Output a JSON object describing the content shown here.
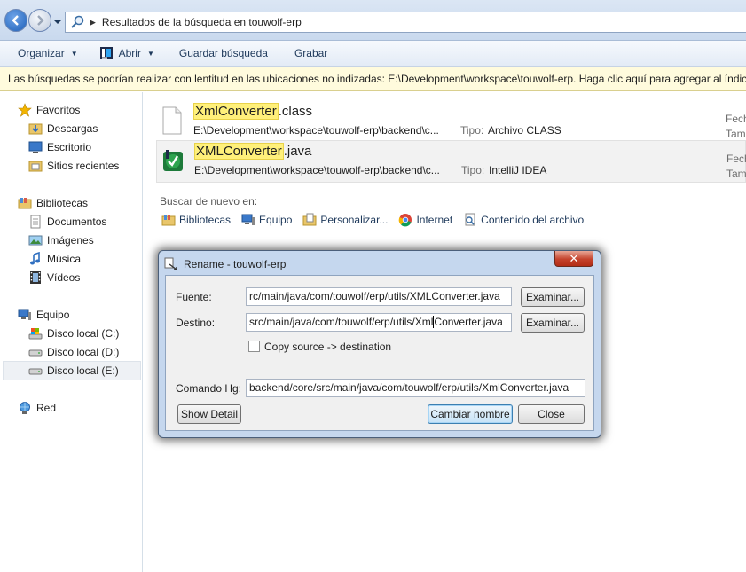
{
  "address": {
    "text": "Resultados de la búsqueda en touwolf-erp"
  },
  "toolbar": {
    "organizar": "Organizar",
    "abrir": "Abrir",
    "guardar": "Guardar búsqueda",
    "grabar": "Grabar"
  },
  "infobar": {
    "text": "Las búsquedas se podrían realizar con lentitud en las ubicaciones no indizadas: E:\\Development\\workspace\\touwolf-erp. Haga clic aquí para agregar al índice..."
  },
  "nav": {
    "favoritos": "Favoritos",
    "descargas": "Descargas",
    "escritorio": "Escritorio",
    "sitios": "Sitios recientes",
    "bibliotecas": "Bibliotecas",
    "documentos": "Documentos",
    "imagenes": "Imágenes",
    "musica": "Música",
    "videos": "Vídeos",
    "equipo": "Equipo",
    "disco_c": "Disco local (C:)",
    "disco_d": "Disco local (D:)",
    "disco_e": "Disco local (E:)",
    "red": "Red"
  },
  "results": [
    {
      "name_match": "XmlConverter",
      "name_rest": ".class",
      "path": "E:\\Development\\workspace\\touwolf-erp\\backend\\c...",
      "type_label": "Tipo:",
      "type": "Archivo CLASS",
      "date_label": "Fech",
      "size_label": "Tam"
    },
    {
      "name_match": "XMLConverter",
      "name_rest": ".java",
      "path": "E:\\Development\\workspace\\touwolf-erp\\backend\\c...",
      "type_label": "Tipo:",
      "type": "IntelliJ IDEA",
      "date_label": "Fech",
      "size_label": "Tam"
    }
  ],
  "search_again": {
    "title": "Buscar de nuevo en:",
    "links": [
      "Bibliotecas",
      "Equipo",
      "Personalizar...",
      "Internet",
      "Contenido del archivo"
    ]
  },
  "dialog": {
    "title": "Rename - touwolf-erp",
    "fuente_label": "Fuente:",
    "fuente_value": "rc/main/java/com/touwolf/erp/utils/XMLConverter.java",
    "destino_label": "Destino:",
    "destino_value_a": "src/main/java/com/touwolf/erp/utils/Xml",
    "destino_value_b": "Converter.java",
    "examinar": "Examinar...",
    "copy_label": "Copy source -> destination",
    "comando_label": "Comando Hg:",
    "comando_value": "backend/core/src/main/java/com/touwolf/erp/utils/XmlConverter.java",
    "show_detail": "Show Detail",
    "cambiar": "Cambiar nombre",
    "close": "Close"
  }
}
